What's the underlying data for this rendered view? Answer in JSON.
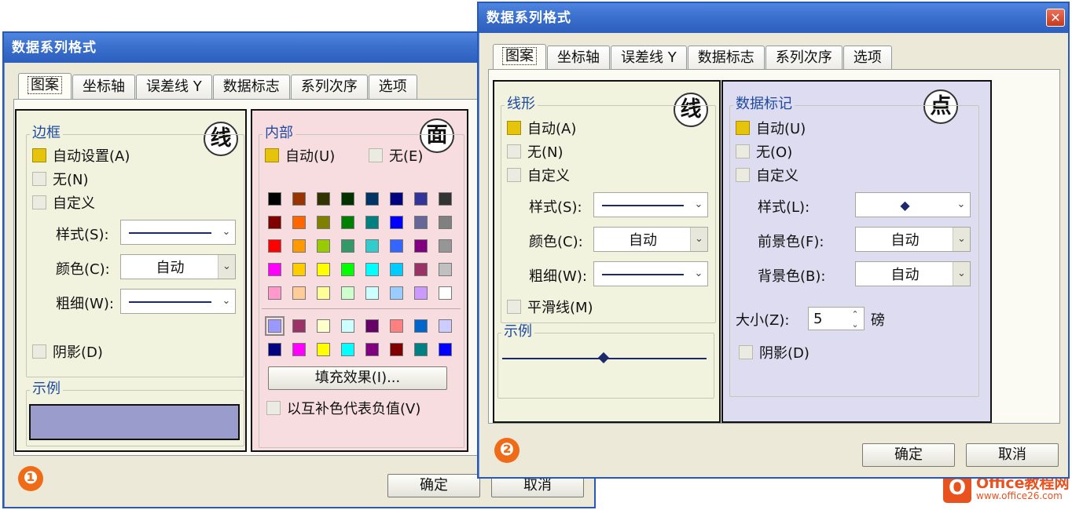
{
  "dialog1": {
    "title": "数据系列格式",
    "tabs": [
      "图案",
      "坐标轴",
      "误差线 Y",
      "数据标志",
      "系列次序",
      "选项"
    ],
    "left": {
      "badge": "线",
      "border_group": "边框",
      "auto": "自动设置(A)",
      "none": "无(N)",
      "custom": "自定义",
      "style_label": "样式(S):",
      "color_label": "颜色(C):",
      "color_value": "自动",
      "weight_label": "粗细(W):",
      "shadow": "阴影(D)",
      "sample_group": "示例",
      "sample_color": "#9a9ccc"
    },
    "right": {
      "badge": "面",
      "area_group": "内部",
      "auto": "自动(U)",
      "none": "无(E)",
      "palette_main": [
        "#000000",
        "#993300",
        "#333300",
        "#003300",
        "#003366",
        "#000080",
        "#333399",
        "#333333",
        "#800000",
        "#ff6600",
        "#808000",
        "#008000",
        "#008080",
        "#0000ff",
        "#666699",
        "#808080",
        "#ff0000",
        "#ff9900",
        "#99cc00",
        "#339966",
        "#33cccc",
        "#3366ff",
        "#800080",
        "#969696",
        "#ff00ff",
        "#ffcc00",
        "#ffff00",
        "#00ff00",
        "#00ffff",
        "#00ccff",
        "#993366",
        "#c0c0c0",
        "#ff99cc",
        "#ffcc99",
        "#ffff99",
        "#ccffcc",
        "#ccffff",
        "#99ccff",
        "#cc99ff",
        "#ffffff"
      ],
      "palette_chart": [
        "#9999ff",
        "#993366",
        "#ffffcc",
        "#ccffff",
        "#660066",
        "#ff8080",
        "#0066cc",
        "#ccccff",
        "#000080",
        "#ff00ff",
        "#ffff00",
        "#00ffff",
        "#800080",
        "#800000",
        "#008080",
        "#0000ff"
      ],
      "fill_effects": "填充效果(I)...",
      "invert": "以互补色代表负值(V)"
    },
    "ok": "确定",
    "cancel": "取消",
    "number": "❶"
  },
  "dialog2": {
    "title": "数据系列格式",
    "close": "✕",
    "tabs": [
      "图案",
      "坐标轴",
      "误差线 Y",
      "数据标志",
      "系列次序",
      "选项"
    ],
    "left": {
      "badge": "线",
      "line_group": "线形",
      "auto": "自动(A)",
      "none": "无(N)",
      "custom": "自定义",
      "style_label": "样式(S):",
      "color_label": "颜色(C):",
      "color_value": "自动",
      "weight_label": "粗细(W):",
      "smooth": "平滑线(M)",
      "sample_group": "示例"
    },
    "right": {
      "badge": "点",
      "marker_group": "数据标记",
      "auto": "自动(U)",
      "none": "无(O)",
      "custom": "自定义",
      "style_label": "样式(L):",
      "style_symbol": "◆",
      "fg_label": "前景色(F):",
      "fg_value": "自动",
      "bg_label": "背景色(B):",
      "bg_value": "自动",
      "size_label": "大小(Z):",
      "size_value": "5",
      "size_unit": "磅",
      "shadow": "阴影(D)"
    },
    "ok": "确定",
    "cancel": "取消",
    "number": "❷"
  },
  "logo": {
    "title": "Office教程网",
    "url": "www.office26.com",
    "icon": "O"
  }
}
